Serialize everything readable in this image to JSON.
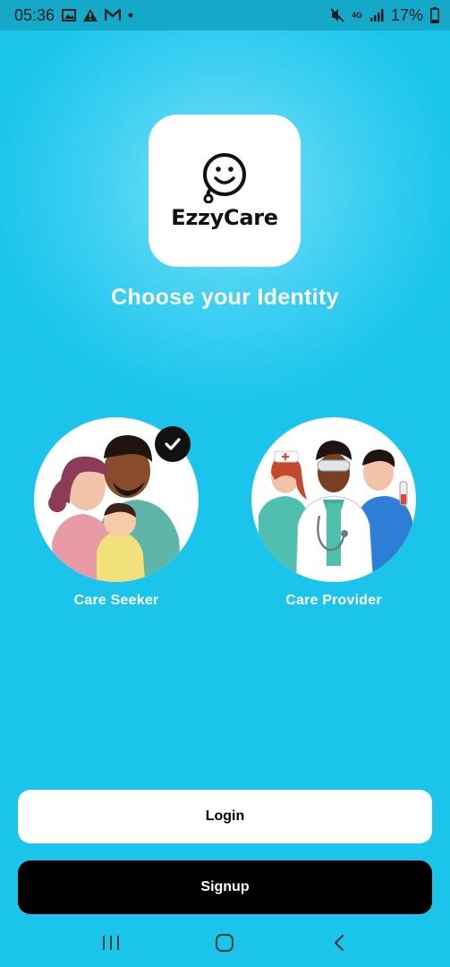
{
  "status_bar": {
    "time": "05:36",
    "network": "4G",
    "battery": "17%"
  },
  "app": {
    "logo_text": "EzzyCare",
    "title": "Choose your Identity"
  },
  "identities": [
    {
      "label": "Care Seeker",
      "selected": true
    },
    {
      "label": "Care Provider",
      "selected": false
    }
  ],
  "actions": {
    "login_label": "Login",
    "signup_label": "Signup"
  },
  "colors": {
    "background": "#1bc4eb",
    "status_bar": "#14a9c9",
    "primary_button": "#ffffff",
    "secondary_button": "#000000"
  },
  "icons": {
    "status_left": [
      "gallery-icon",
      "warning-icon",
      "gmail-icon",
      "dot-icon"
    ],
    "status_right": [
      "mute-icon",
      "signal-icon",
      "battery-icon"
    ],
    "navigation": [
      "recents-icon",
      "home-icon",
      "back-icon"
    ]
  }
}
